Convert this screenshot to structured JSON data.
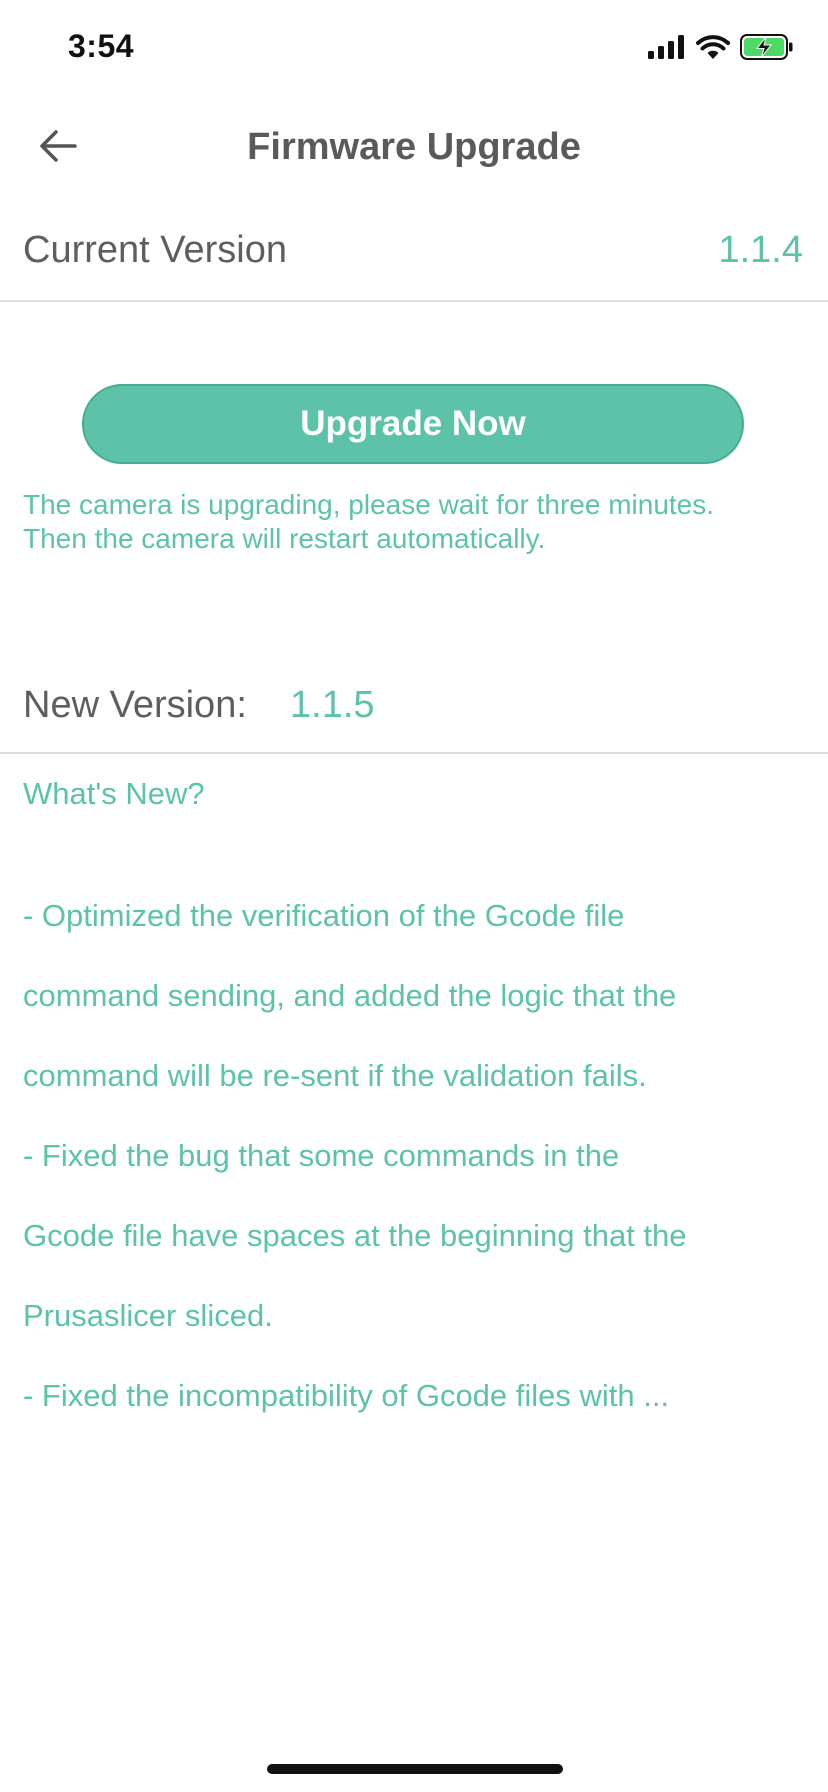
{
  "status_bar": {
    "time": "3:54",
    "icons": [
      "signal-icon",
      "wifi-icon",
      "battery-charging-icon"
    ]
  },
  "nav": {
    "back_icon": "arrow-left-icon",
    "title": "Firmware Upgrade"
  },
  "current_version": {
    "label": "Current Version",
    "value": "1.1.4"
  },
  "upgrade": {
    "button_label": "Upgrade Now",
    "note_line1": "The camera is upgrading, please wait for three minutes.",
    "note_line2": "Then the camera will restart automatically."
  },
  "new_version": {
    "label": "New Version:",
    "value": "1.1.5"
  },
  "release_notes": {
    "title": "What's New?",
    "lines": [
      "- Optimized the verification of the Gcode file",
      "command sending, and added the logic that the",
      "command will be re-sent if the validation fails.",
      "- Fixed the bug that some commands in the",
      "Gcode file have spaces at the beginning that the",
      "Prusaslicer sliced.",
      "- Fixed the incompatibility of Gcode files with ..."
    ]
  },
  "colors": {
    "accent": "#5cc3a9",
    "text": "#5e5e5e",
    "divider": "#dcdcdc"
  }
}
